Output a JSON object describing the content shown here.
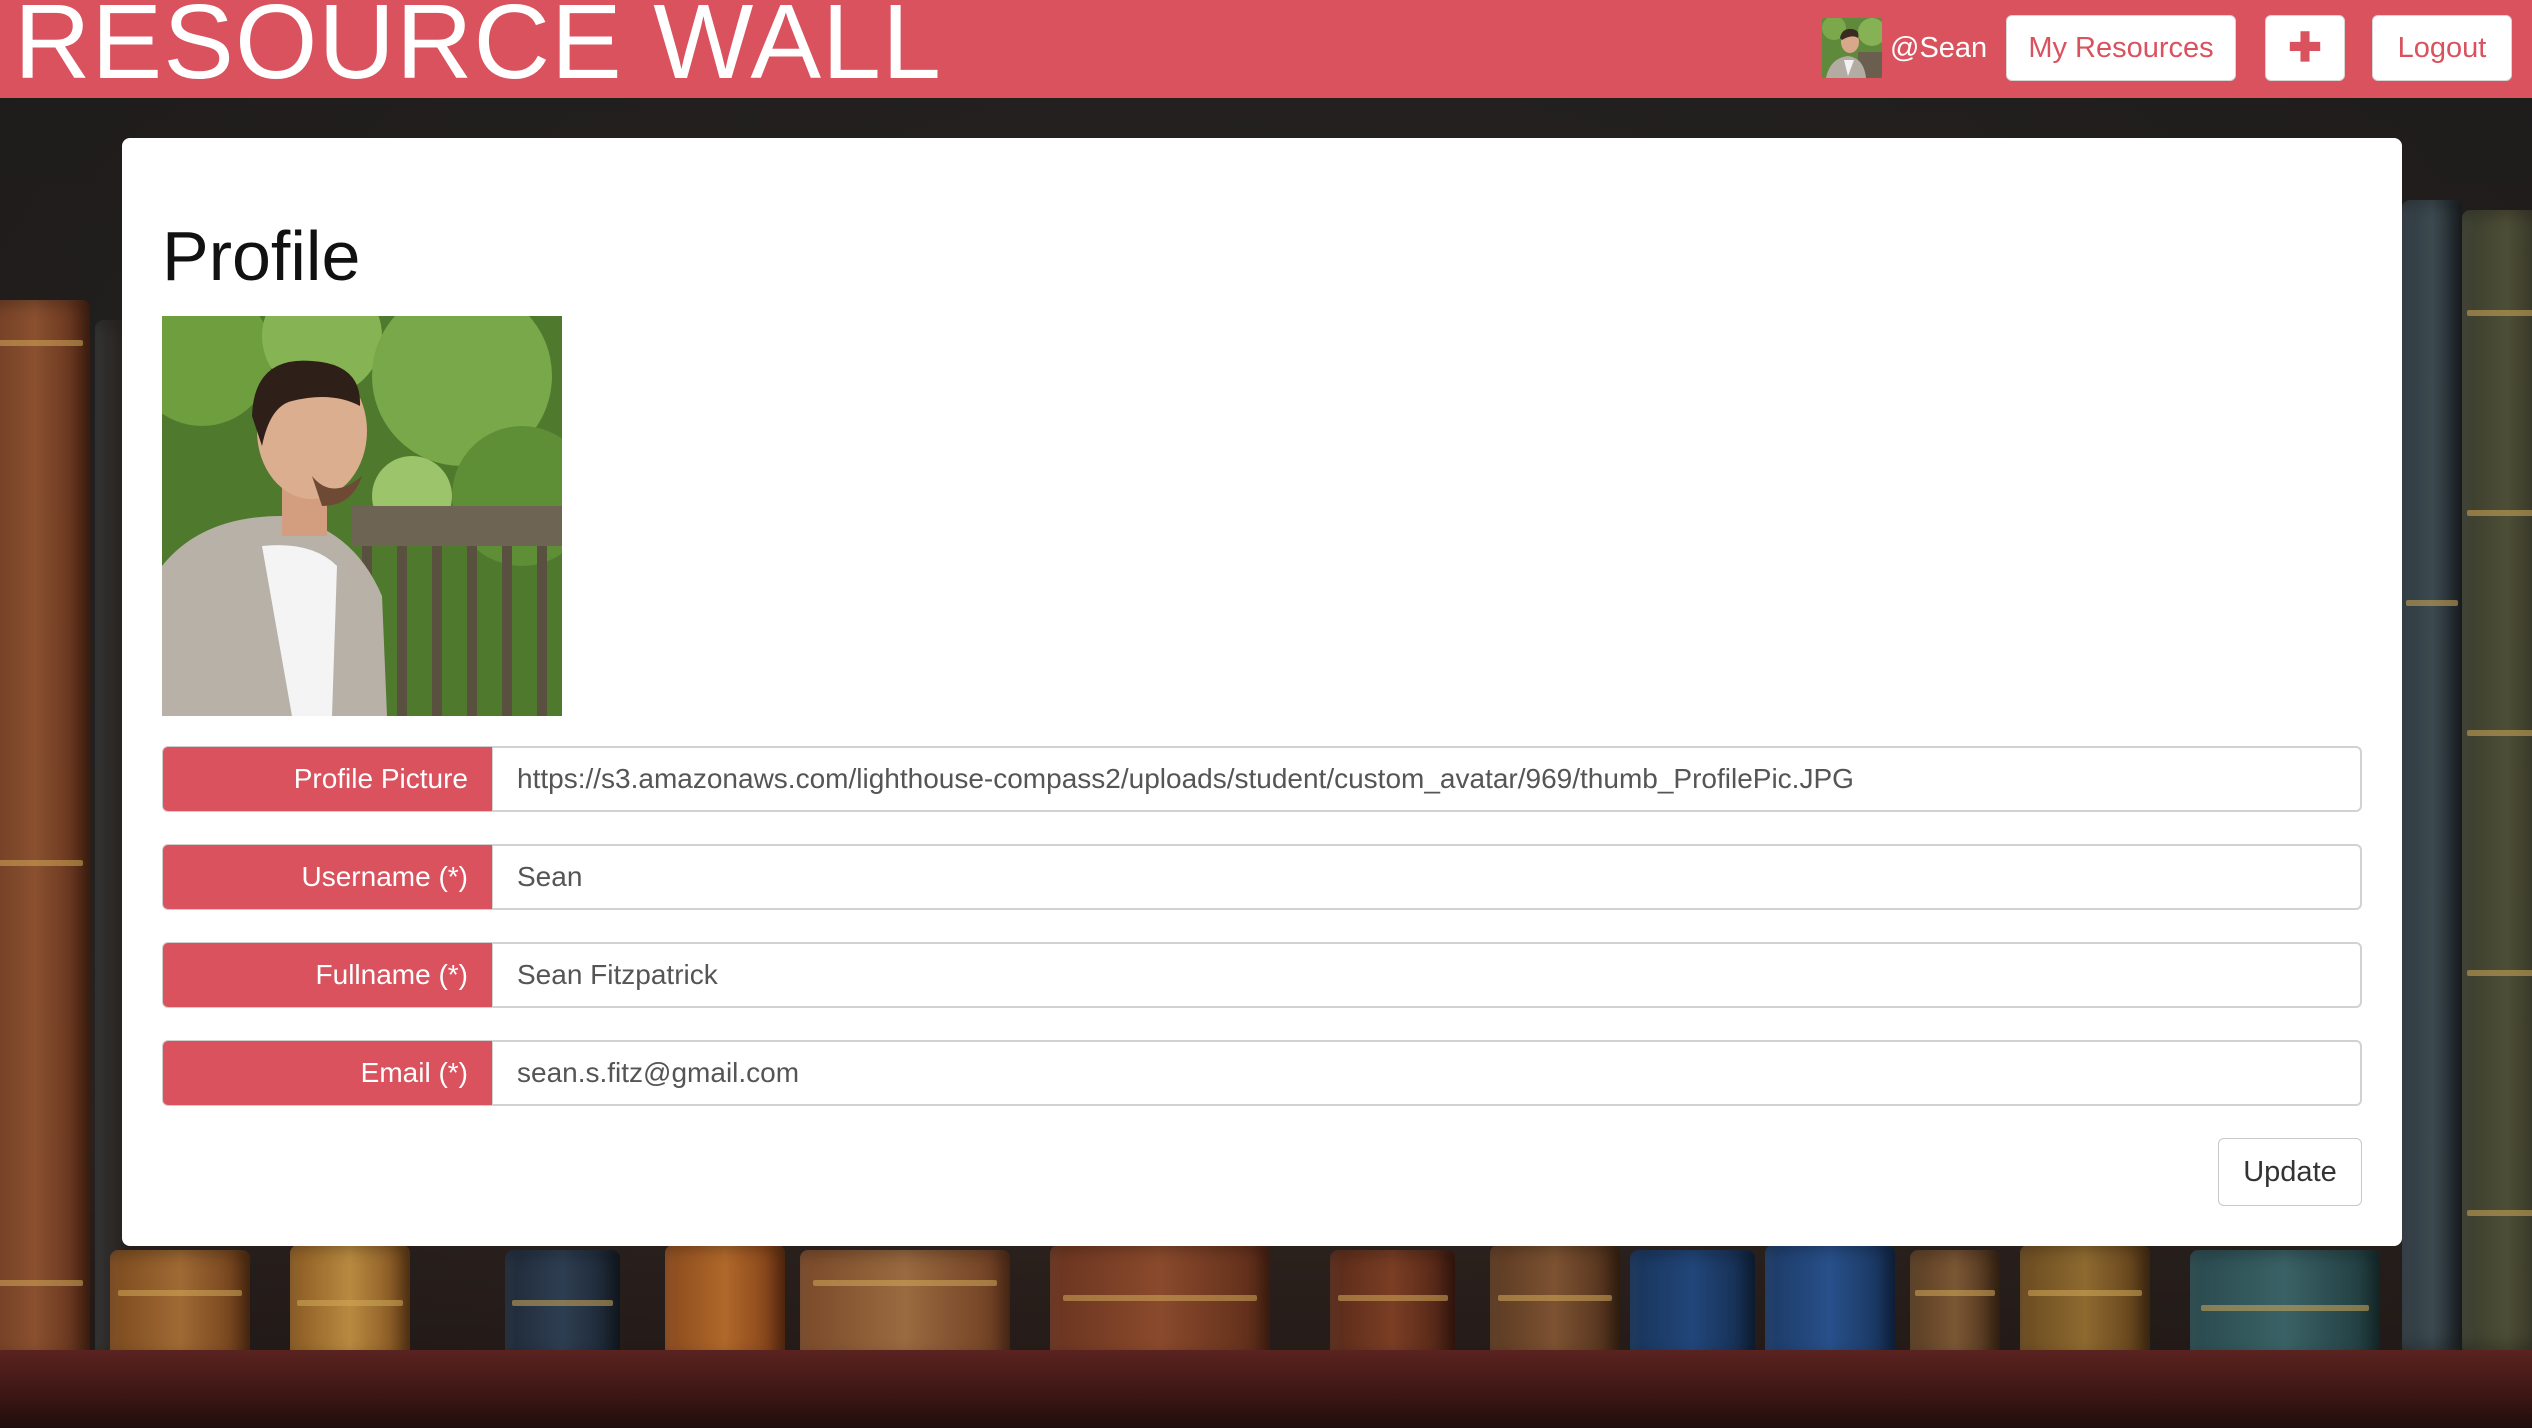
{
  "navbar": {
    "brand": "RESOURCE WALL",
    "username": "@Sean",
    "my_resources_label": "My Resources",
    "add_label": "✚",
    "logout_label": "Logout"
  },
  "profile": {
    "title": "Profile",
    "fields": [
      {
        "label": "Profile Picture",
        "value": "https://s3.amazonaws.com/lighthouse-compass2/uploads/student/custom_avatar/969/thumb_ProfilePic.JPG"
      },
      {
        "label": "Username (*)",
        "value": "Sean"
      },
      {
        "label": "Fullname (*)",
        "value": "Sean Fitzpatrick"
      },
      {
        "label": "Email (*)",
        "value": "sean.s.fitz@gmail.com"
      }
    ],
    "update_label": "Update"
  },
  "colors": {
    "accent": "#d9525e",
    "card_bg": "#ffffff",
    "page_bg": "#2a2522"
  }
}
